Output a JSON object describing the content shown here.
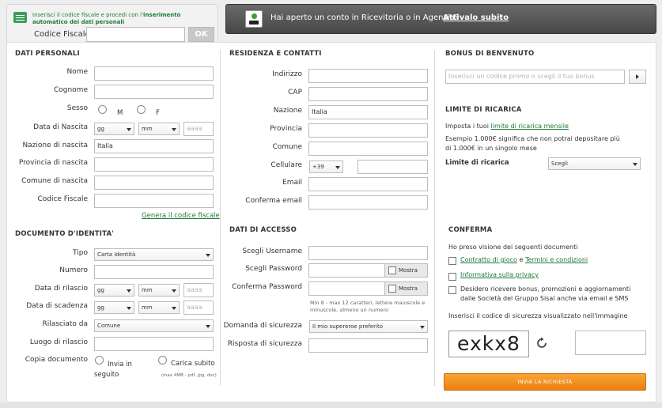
{
  "top_box": {
    "message_prefix": "Inserisci il codice fiscale e procedi con l'",
    "message_bold": "inserimento automatico dei dati personali",
    "cf_label": "Codice Fiscale",
    "ok_label": "OK"
  },
  "banner": {
    "text": "Hai aperto un conto in Ricevitoria o in Agenzia?",
    "link": "Attivalo subito"
  },
  "personal": {
    "title": "DATI PERSONALI",
    "nome": "Nome",
    "cognome": "Cognome",
    "sesso": "Sesso",
    "sesso_m": "M",
    "sesso_f": "F",
    "data_nascita": "Data di Nascita",
    "gg": "gg",
    "mm": "mm",
    "aaaa": "aaaa",
    "nazione_nascita": "Nazione di nascita",
    "nazione_value": "Italia",
    "provincia_nascita": "Provincia di nascita",
    "comune_nascita": "Comune di nascita",
    "codice_fiscale": "Codice Fiscale",
    "genera_link": "Genera il codice fiscale"
  },
  "document": {
    "title": "DOCUMENTO D'IDENTITA'",
    "tipo": "Tipo",
    "tipo_value": "Carta Identità",
    "numero": "Numero",
    "data_rilascio": "Data di rilascio",
    "data_scadenza": "Data di scadenza",
    "gg": "gg",
    "mm": "mm",
    "aaaa": "aaaa",
    "rilasciato_da": "Rilasciato da",
    "rilasciato_value": "Comune",
    "luogo_rilascio": "Luogo di rilascio",
    "copia_documento": "Copia documento",
    "invia_in_seguito": "Invia in seguito",
    "carica_subito": "Carica subito",
    "file_hint": "(max 4MB - pdf, jpg, doc)"
  },
  "residence": {
    "title": "RESIDENZA E CONTATTI",
    "indirizzo": "Indirizzo",
    "cap": "CAP",
    "nazione": "Nazione",
    "nazione_value": "Italia",
    "provincia": "Provincia",
    "comune": "Comune",
    "cellulare": "Cellulare",
    "prefix": "+39",
    "email": "Email",
    "conferma_email": "Conferma email"
  },
  "access": {
    "title": "DATI DI ACCESSO",
    "username": "Scegli Username",
    "password": "Scegli Password",
    "conferma_password": "Conferma Password",
    "mostra": "Mostra",
    "password_hint": "Min 8 - max 12 caratteri, lettere maiuscole e minuscole, almeno un numero",
    "domanda": "Domanda di sicurezza",
    "domanda_value": "Il mio supereroe preferito",
    "risposta": "Risposta di sicurezza"
  },
  "bonus": {
    "title": "BONUS DI BENVENUTO",
    "placeholder": "Inserisci un codice promo o scegli il tuo bonus"
  },
  "limit": {
    "title": "LIMITE DI RICARICA",
    "text_prefix": "Imposta i tuoi ",
    "text_link": "limite di ricarica mensile",
    "example": "Esempio 1.000€ significa che non potrai depositare più di 1.000€ in un singolo mese",
    "label": "Limite di ricarica",
    "select_value": "Scegli"
  },
  "confirm": {
    "title": "CONFERMA",
    "intro": "Ho preso visione dei seguenti documenti",
    "contratto": "Contratto di gioco",
    "e": " e ",
    "termini": "Termini e condizioni",
    "privacy": "Informativa sulla privacy",
    "promo": "Desidero ricevere bonus, promozioni e aggiornamenti dalle Società del Gruppo Sisal anche via email e SMS",
    "captcha_prompt": "Inserisci il codice di sicurezza visualizzato nell'immagine",
    "captcha_text": "exkx8",
    "submit": "INVIA LA RICHIESTA"
  },
  "colors": {
    "accent_green": "#1f7a36",
    "submit_orange": "#ee7f12",
    "banner_dark": "#474747"
  }
}
